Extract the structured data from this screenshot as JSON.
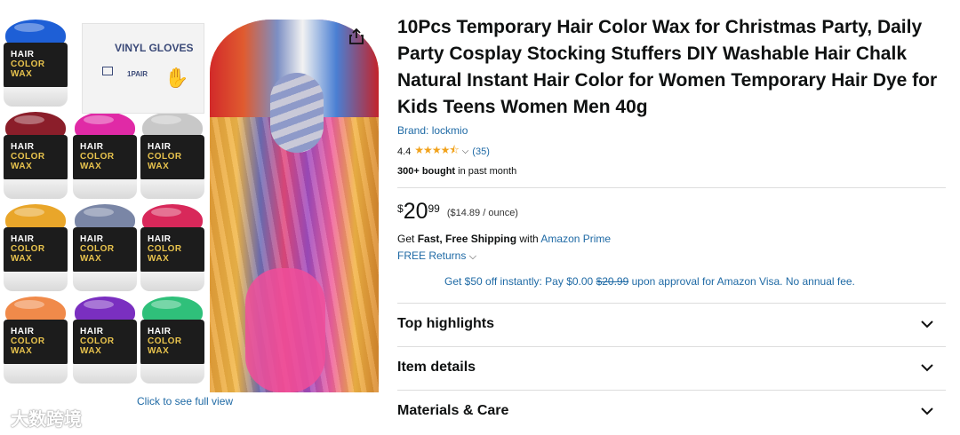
{
  "gallery": {
    "jar_label": [
      "HAIR",
      "COLOR WAX"
    ],
    "gloves_title": "VINYL GLOVES",
    "gloves_pair": "1PAIR",
    "see_full": "Click to see full view",
    "watermark": "大数跨境",
    "jar_colors": [
      "#1e5fd6",
      "#8b1e2a",
      "#e02aa6",
      "#c8c8c8",
      "#e9a62a",
      "#7a86a6",
      "#d8285a",
      "#f08a4a",
      "#7a2fc0",
      "#2fc07a"
    ]
  },
  "product": {
    "title": "10Pcs Temporary Hair Color Wax for Christmas Party, Daily Party Cosplay Stocking Stuffers DIY Washable Hair Chalk Natural Instant Hair Color for Women Temporary Hair Dye for Kids Teens Women Men 40g",
    "brand": "Brand: lockmio",
    "rating_value": "4.4",
    "stars": "★★★★⯪",
    "review_count": "(35)",
    "bought_bold": "300+ bought",
    "bought_rest": " in past month",
    "price_symbol": "$",
    "price_whole": "20",
    "price_fraction": "99",
    "price_per_unit": "($14.89 / ounce)",
    "ship_prefix": "Get ",
    "ship_bold": "Fast, Free Shipping",
    "ship_with": " with ",
    "ship_link": "Amazon Prime",
    "returns": "FREE Returns",
    "promo_a": "Get $50 off instantly: Pay $0.00 ",
    "promo_strike": "$20.99",
    "promo_b": " upon approval for Amazon Visa. No annual fee."
  },
  "accordions": [
    "Top highlights",
    "Item details",
    "Materials & Care"
  ],
  "colors": {
    "link": "#1f6aa5",
    "star": "#f1a21b",
    "divider": "#dddddd"
  }
}
